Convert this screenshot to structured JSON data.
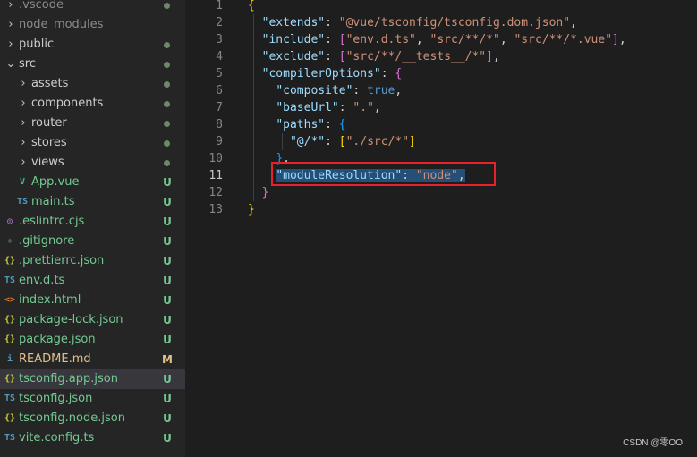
{
  "explorer": {
    "items": [
      {
        "label": ".vscode",
        "kind": "folder",
        "indent": 0,
        "status": "dot",
        "dim": true
      },
      {
        "label": "node_modules",
        "kind": "folder",
        "indent": 0,
        "status": "",
        "dim": true
      },
      {
        "label": "public",
        "kind": "folder",
        "indent": 0,
        "status": "dot"
      },
      {
        "label": "src",
        "kind": "folder-open",
        "indent": 0,
        "status": "dot"
      },
      {
        "label": "assets",
        "kind": "folder",
        "indent": 1,
        "status": "dot"
      },
      {
        "label": "components",
        "kind": "folder",
        "indent": 1,
        "status": "dot"
      },
      {
        "label": "router",
        "kind": "folder",
        "indent": 1,
        "status": "dot"
      },
      {
        "label": "stores",
        "kind": "folder",
        "indent": 1,
        "status": "dot"
      },
      {
        "label": "views",
        "kind": "folder",
        "indent": 1,
        "status": "dot"
      },
      {
        "label": "App.vue",
        "kind": "vue",
        "indent": 1,
        "status": "U"
      },
      {
        "label": "main.ts",
        "kind": "ts",
        "indent": 1,
        "status": "U"
      },
      {
        "label": ".eslintrc.cjs",
        "kind": "eslint",
        "indent": 0,
        "status": "U"
      },
      {
        "label": ".gitignore",
        "kind": "git",
        "indent": 0,
        "status": "U"
      },
      {
        "label": ".prettierrc.json",
        "kind": "json",
        "indent": 0,
        "status": "U"
      },
      {
        "label": "env.d.ts",
        "kind": "ts",
        "indent": 0,
        "status": "U"
      },
      {
        "label": "index.html",
        "kind": "html",
        "indent": 0,
        "status": "U"
      },
      {
        "label": "package-lock.json",
        "kind": "json",
        "indent": 0,
        "status": "U"
      },
      {
        "label": "package.json",
        "kind": "json",
        "indent": 0,
        "status": "U"
      },
      {
        "label": "README.md",
        "kind": "info",
        "indent": 0,
        "status": "M"
      },
      {
        "label": "tsconfig.app.json",
        "kind": "json",
        "indent": 0,
        "status": "U",
        "selected": true
      },
      {
        "label": "tsconfig.json",
        "kind": "tsconfig",
        "indent": 0,
        "status": "U"
      },
      {
        "label": "tsconfig.node.json",
        "kind": "json",
        "indent": 0,
        "status": "U"
      },
      {
        "label": "vite.config.ts",
        "kind": "ts",
        "indent": 0,
        "status": "U"
      }
    ],
    "icon_glyphs": {
      "vue": "V",
      "ts": "TS",
      "json": "{}",
      "html": "<>",
      "info": "i",
      "tsconfig": "TS",
      "eslint": "◎",
      "git": "◆"
    }
  },
  "editor": {
    "active_line": 11,
    "lines": [
      {
        "n": "1",
        "tokens": [
          [
            "b1",
            "{"
          ]
        ]
      },
      {
        "n": "2",
        "tokens": [
          [
            "p",
            "  "
          ],
          [
            "k",
            "\"extends\""
          ],
          [
            "p",
            ": "
          ],
          [
            "s",
            "\"@vue/tsconfig/tsconfig.dom.json\""
          ],
          [
            "p",
            ","
          ]
        ]
      },
      {
        "n": "3",
        "tokens": [
          [
            "p",
            "  "
          ],
          [
            "k",
            "\"include\""
          ],
          [
            "p",
            ": "
          ],
          [
            "b2",
            "["
          ],
          [
            "s",
            "\"env.d.ts\""
          ],
          [
            "p",
            ", "
          ],
          [
            "s",
            "\"src/**/*\""
          ],
          [
            "p",
            ", "
          ],
          [
            "s",
            "\"src/**/*.vue\""
          ],
          [
            "b2",
            "]"
          ],
          [
            "p",
            ","
          ]
        ]
      },
      {
        "n": "4",
        "tokens": [
          [
            "p",
            "  "
          ],
          [
            "k",
            "\"exclude\""
          ],
          [
            "p",
            ": "
          ],
          [
            "b2",
            "["
          ],
          [
            "s",
            "\"src/**/__tests__/*\""
          ],
          [
            "b2",
            "]"
          ],
          [
            "p",
            ","
          ]
        ]
      },
      {
        "n": "5",
        "tokens": [
          [
            "p",
            "  "
          ],
          [
            "k",
            "\"compilerOptions\""
          ],
          [
            "p",
            ": "
          ],
          [
            "b2",
            "{"
          ]
        ]
      },
      {
        "n": "6",
        "tokens": [
          [
            "p",
            "    "
          ],
          [
            "k",
            "\"composite\""
          ],
          [
            "p",
            ": "
          ],
          [
            "bool",
            "true"
          ],
          [
            "p",
            ","
          ]
        ]
      },
      {
        "n": "7",
        "tokens": [
          [
            "p",
            "    "
          ],
          [
            "k",
            "\"baseUrl\""
          ],
          [
            "p",
            ": "
          ],
          [
            "s",
            "\".\""
          ],
          [
            "p",
            ","
          ]
        ]
      },
      {
        "n": "8",
        "tokens": [
          [
            "p",
            "    "
          ],
          [
            "k",
            "\"paths\""
          ],
          [
            "p",
            ": "
          ],
          [
            "b3",
            "{"
          ]
        ]
      },
      {
        "n": "9",
        "tokens": [
          [
            "p",
            "      "
          ],
          [
            "k",
            "\"@/*\""
          ],
          [
            "p",
            ": "
          ],
          [
            "b1",
            "["
          ],
          [
            "s",
            "\"./src/*\""
          ],
          [
            "b1",
            "]"
          ]
        ]
      },
      {
        "n": "10",
        "tokens": [
          [
            "p",
            "    "
          ],
          [
            "b3",
            "}"
          ],
          [
            "p",
            ","
          ]
        ]
      },
      {
        "n": "11",
        "tokens": [
          [
            "p",
            "    "
          ],
          [
            "k sel-bg",
            "\"moduleResolution\""
          ],
          [
            "p sel-bg",
            ": "
          ],
          [
            "s sel-bg",
            "\"node\""
          ],
          [
            "p sel-bg",
            ","
          ]
        ]
      },
      {
        "n": "12",
        "tokens": [
          [
            "p",
            "  "
          ],
          [
            "b2",
            "}"
          ]
        ]
      },
      {
        "n": "13",
        "tokens": [
          [
            "b1",
            "}"
          ]
        ]
      }
    ]
  },
  "watermark": "CSDN @零OO"
}
